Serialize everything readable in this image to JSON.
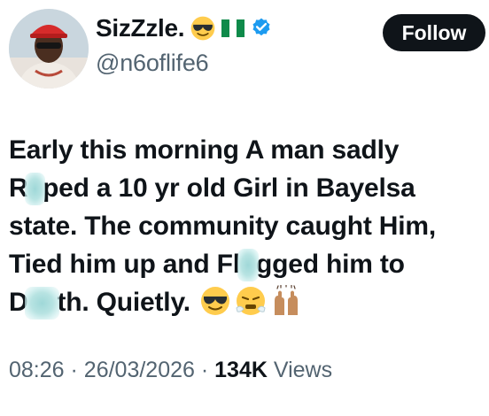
{
  "author": {
    "display_name": "SizZzle.",
    "handle": "@n6oflife6",
    "badges": [
      "smiling-face-with-sunglasses-icon",
      "nigeria-flag-icon",
      "verified-badge-icon"
    ]
  },
  "follow_button": {
    "label": "Follow"
  },
  "tweet": {
    "lines": [
      "Early this morning A man sadly",
      {
        "before": "R",
        "censored": "a",
        "after": "ped a 10 yr old Girl in Bayelsa"
      },
      "state. The community caught Him,",
      {
        "before": "Tied him up and Fl",
        "censored": "o",
        "after": "gged him to"
      },
      {
        "before": "D",
        "censored": "ea",
        "after": "th. Quietly."
      }
    ],
    "emojis": [
      "smiling-face-with-sunglasses-icon",
      "face-with-steam-icon",
      "raising-hands-icon"
    ]
  },
  "meta": {
    "time": "08:26",
    "date": "26/03/2026",
    "views_count": "134K",
    "views_label": "Views",
    "separator": "·"
  },
  "colors": {
    "text": "#0f1419",
    "muted": "#536471",
    "verified": "#1d9bf0",
    "follow_bg": "#0f1419",
    "censor": "#9fd8d8"
  }
}
